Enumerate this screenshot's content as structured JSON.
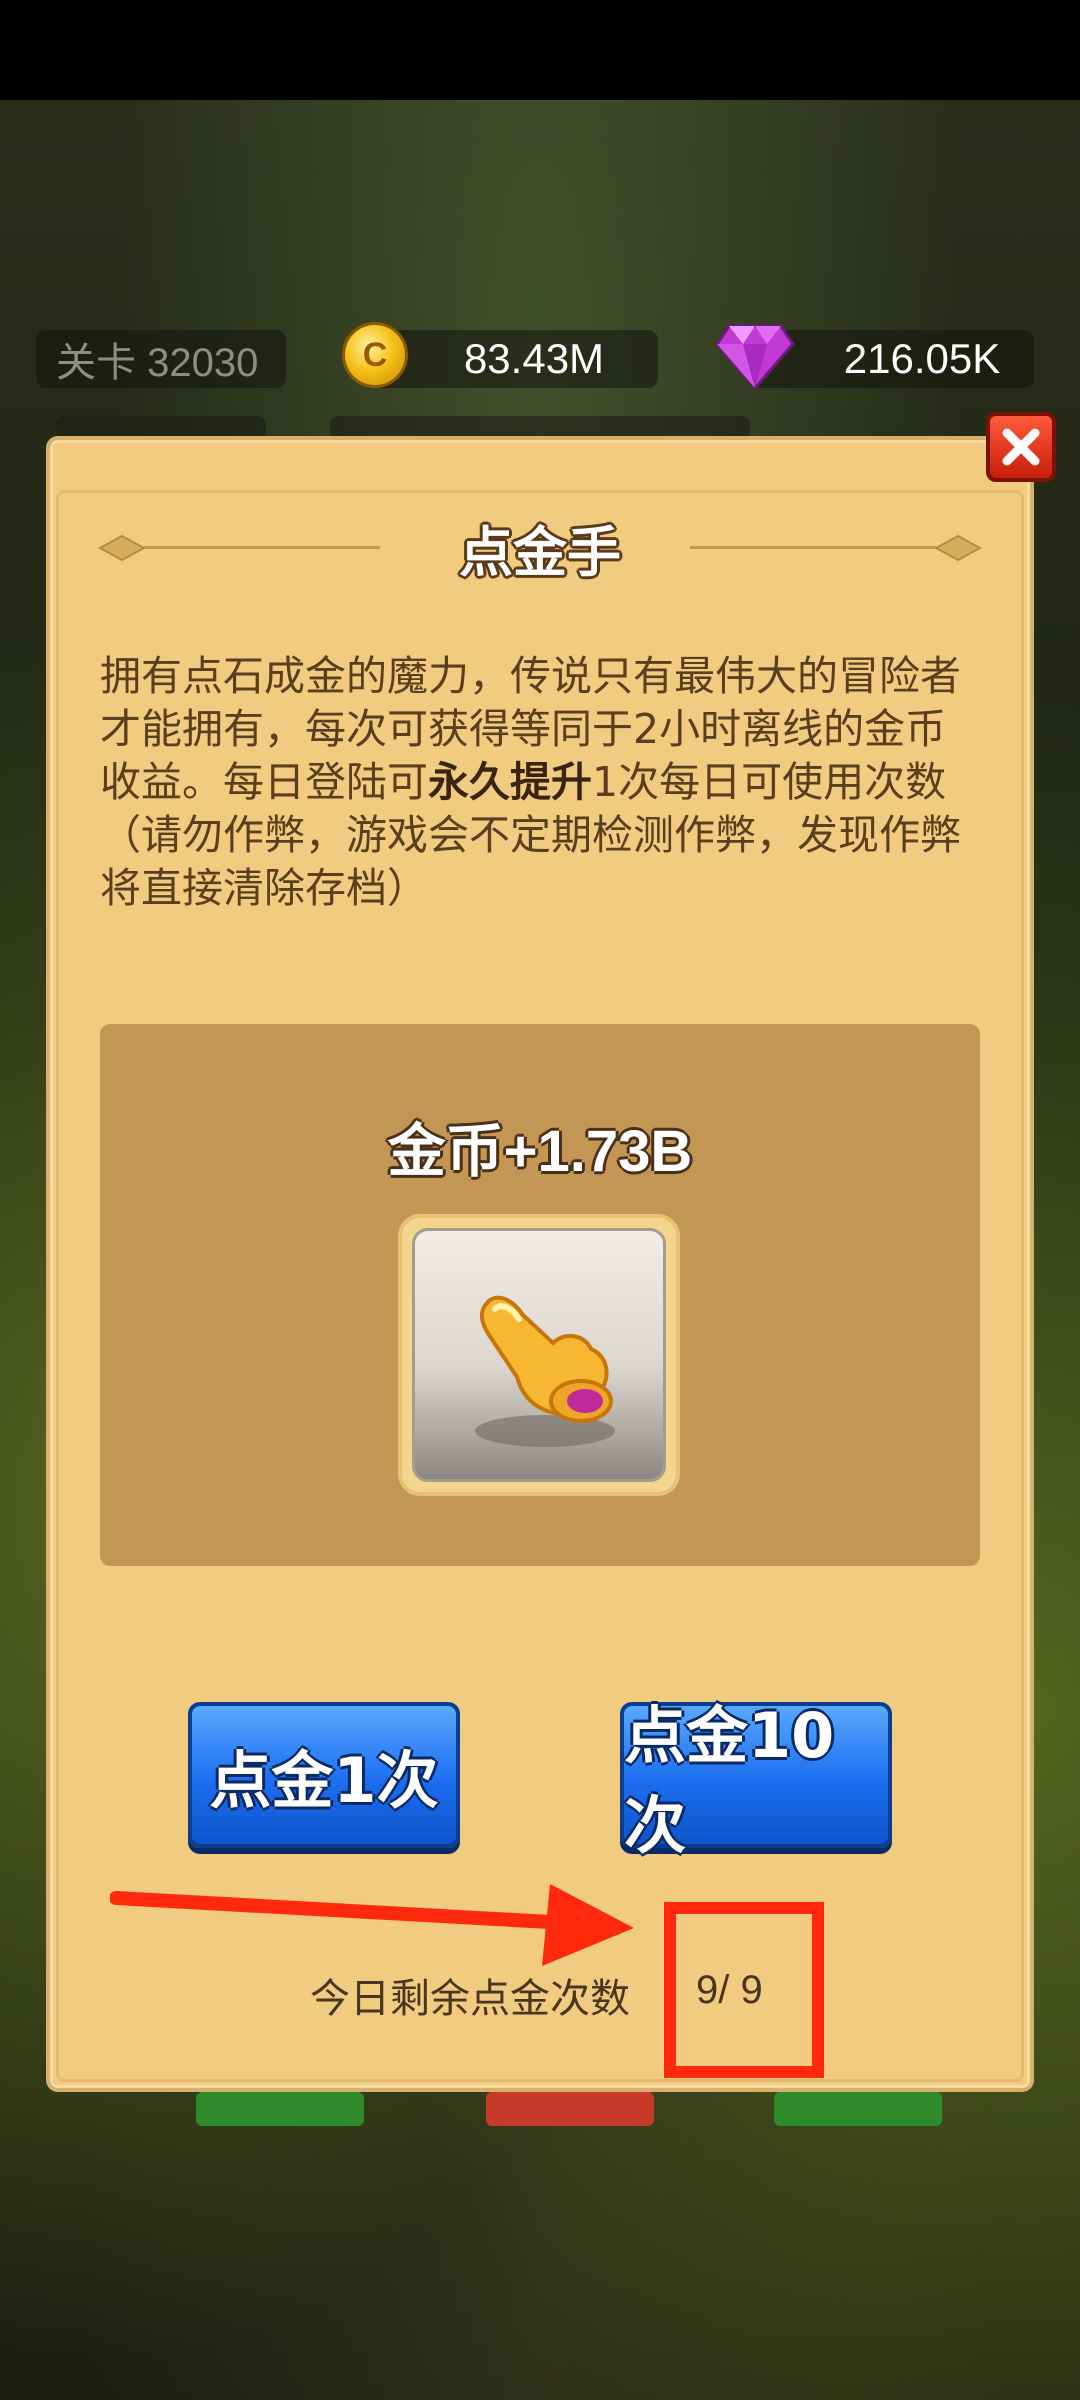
{
  "hud": {
    "level": "关卡 32030",
    "gold": "83.43M",
    "gems": "216.05K"
  },
  "dialog": {
    "title": "点金手",
    "desc_part1": "拥有点石成金的魔力，传说只有最伟大的冒险者才能拥有，每次可获得等同于2小时离线的金币收益。每日登陆可",
    "desc_bold": "永久提升",
    "desc_part2": "1次每日可使用次数（请勿作弊，游戏会不定期检测作弊，发现作弊将直接清除存档）",
    "reward": "金币+1.73B",
    "button_once": "点金1次",
    "button_ten": "点金10次",
    "remaining_label": "今日剩余点金次数",
    "remaining_value": "9/ 9"
  },
  "colors": {
    "panel": "#f0cb80",
    "button": "#1c6ef0",
    "annotation": "#ff2a0e"
  },
  "icons": {
    "coin": "gold-coin-icon",
    "gem": "purple-gem-icon",
    "close": "close-icon",
    "item": "golden-pointing-hand-icon"
  }
}
